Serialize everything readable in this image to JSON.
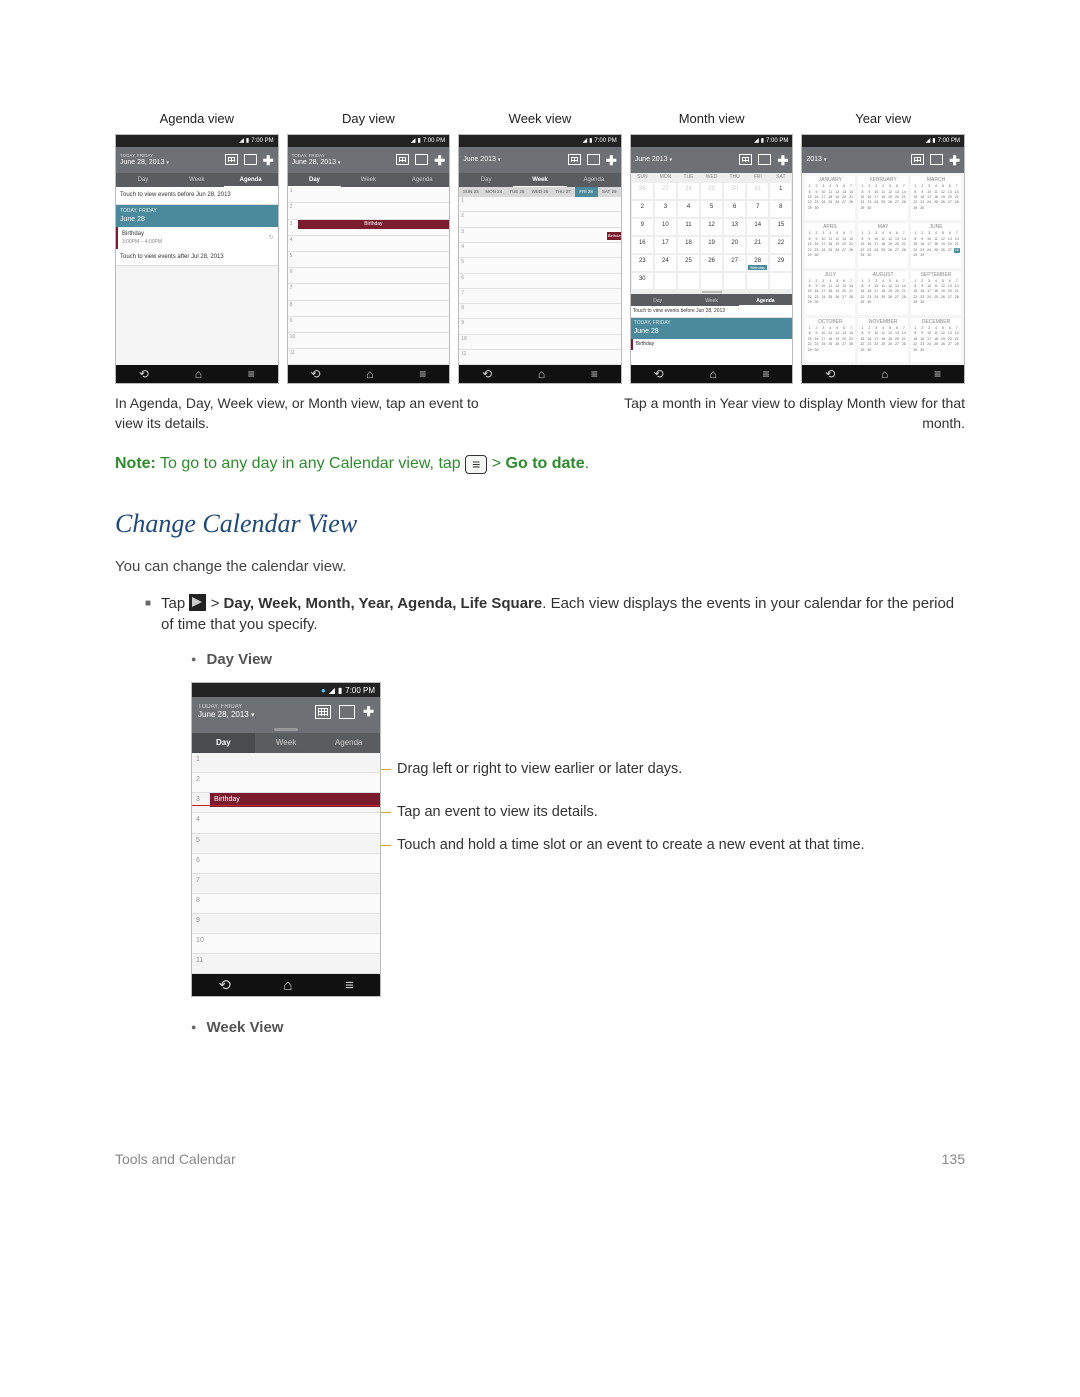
{
  "views": {
    "labels": [
      "Agenda view",
      "Day view",
      "Week view",
      "Month view",
      "Year view"
    ],
    "status_time": "7:00 PM",
    "agenda": {
      "header_sub": "TODAY, FRIDAY",
      "header_date": "June 28, 2013",
      "touch_before": "Touch to view events before Jun 28, 2013",
      "today_label": "TODAY, FRIDAY",
      "date_big": "June 28",
      "event_name": "Birthday",
      "event_time": "3:00PM – 4:00PM",
      "touch_after": "Touch to view events after Jul 28, 2013",
      "tabs": [
        "Day",
        "Week",
        "Agenda"
      ]
    },
    "day": {
      "header_sub": "TODAY, FRIDAY",
      "header_date": "June 28, 2013",
      "tabs": [
        "Day",
        "Week",
        "Agenda"
      ],
      "event": "Birthday",
      "hours": [
        "1",
        "2",
        "3",
        "4",
        "5",
        "6",
        "7",
        "8",
        "9",
        "10",
        "11"
      ]
    },
    "week": {
      "header": "June 2013",
      "tabs": [
        "Day",
        "Week",
        "Agenda"
      ],
      "days": [
        "SUN 23",
        "MON 24",
        "TUE 25",
        "WED 26",
        "THU 27",
        "FRI 28",
        "SAT 29"
      ],
      "event": "Birthday",
      "hours": [
        "1",
        "2",
        "3",
        "4",
        "5",
        "6",
        "7",
        "8",
        "9",
        "10",
        "11"
      ]
    },
    "month": {
      "header": "June 2013",
      "dow": [
        "SUN",
        "MON",
        "TUE",
        "WED",
        "THU",
        "FRI",
        "SAT"
      ],
      "prev": [
        26,
        27,
        28,
        29,
        30,
        31
      ],
      "days": [
        1,
        2,
        3,
        4,
        5,
        6,
        7,
        8,
        9,
        10,
        11,
        12,
        13,
        14,
        15,
        16,
        17,
        18,
        19,
        20,
        21,
        22,
        23,
        24,
        25,
        26,
        27,
        28,
        29,
        30
      ],
      "event_day": 28,
      "event_label": "Birthday",
      "agenda_touch": "Touch to view events before Jun 28, 2013",
      "agenda_today": "TODAY, FRIDAY",
      "agenda_big": "June 28",
      "agenda_event": "Birthday",
      "tabs": [
        "Day",
        "Week",
        "Agenda"
      ]
    },
    "year": {
      "header": "2013",
      "months": [
        "JANUARY",
        "FEBRUARY",
        "MARCH",
        "APRIL",
        "MAY",
        "JUNE",
        "JULY",
        "AUGUST",
        "SEPTEMBER",
        "OCTOBER",
        "NOVEMBER",
        "DECEMBER"
      ]
    }
  },
  "captions": {
    "left": "In Agenda, Day, Week view, or Month view, tap an event to view its details.",
    "right": "Tap a month in Year view to display Month view for that month."
  },
  "note": {
    "label": "Note:",
    "text": "  To go to any day in any Calendar view, tap ",
    "menu_glyph": "≡",
    "gt": " > ",
    "goto": "Go to date",
    "period": "."
  },
  "section_heading": "Change Calendar View",
  "intro": "You can change the calendar view.",
  "bullet1": {
    "pre": "Tap ",
    "post": " > ",
    "views": "Day, Week, Month, Year, Agenda, Life Square",
    "rest": ". Each view displays the events in your calendar for the period of time that you specify."
  },
  "sub": {
    "day": "Day View",
    "week": "Week View"
  },
  "dayview": {
    "status_time": "7:00 PM",
    "header_sub": "TODAY, FRIDAY",
    "header_date": "June 28, 2013",
    "tabs": [
      "Day",
      "Week",
      "Agenda"
    ],
    "event": "Birthday",
    "hours": [
      "1",
      "2",
      "3",
      "4",
      "5",
      "6",
      "7",
      "8",
      "9",
      "10",
      "11"
    ],
    "callouts": [
      "Drag left or right to view earlier or later days.",
      "Tap an event to view its details.",
      "Touch and hold a time slot or an event to create a new event at that time."
    ]
  },
  "footer": {
    "left": "Tools and Calendar",
    "right": "135"
  }
}
